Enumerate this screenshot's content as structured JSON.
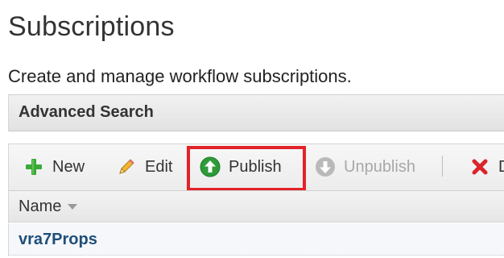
{
  "page": {
    "title": "Subscriptions",
    "subtitle": "Create and manage workflow subscriptions."
  },
  "advanced_search": {
    "label": "Advanced Search"
  },
  "toolbar": {
    "new_label": "New",
    "edit_label": "Edit",
    "publish_label": "Publish",
    "unpublish_label": "Unpublish",
    "delete_label": "D"
  },
  "grid": {
    "columns": [
      {
        "label": "Name",
        "sort": "descending"
      }
    ],
    "rows": [
      {
        "name": "vra7Props"
      }
    ]
  },
  "colors": {
    "highlight": "#e3222a",
    "link": "#1f4e79",
    "new_icon": "#3aa936",
    "publish_icon": "#2e9a38",
    "delete_icon": "#d9252b"
  },
  "icons": {
    "new": "plus-icon",
    "edit": "pencil-icon",
    "publish": "arrow-up-circle-icon",
    "unpublish": "arrow-down-circle-icon",
    "delete": "x-icon",
    "sort": "sort-down-icon"
  }
}
